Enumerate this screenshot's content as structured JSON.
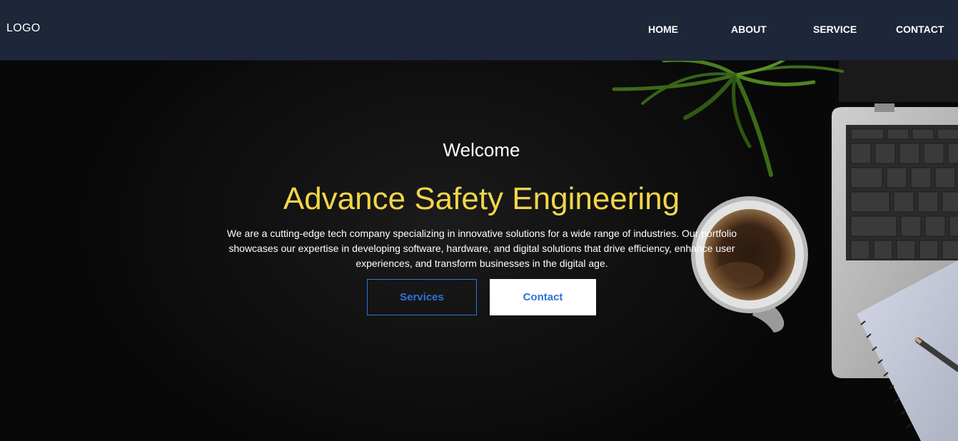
{
  "header": {
    "logo": "LOGO",
    "nav": {
      "home": "HOME",
      "about": "ABOUT",
      "service": "SERVICE",
      "contact": "CONTACT"
    }
  },
  "hero": {
    "welcome": "Welcome",
    "title": "Advance Safety Engineering",
    "description": "We are a cutting-edge tech company specializing in innovative solutions for a wide range of industries. Our portfolio showcases our expertise in developing software, hardware, and digital solutions that drive efficiency, enhance user experiences, and transform businesses in the digital age.",
    "buttons": {
      "services": "Services",
      "contact": "Contact"
    }
  },
  "colors": {
    "navbar_bg": "#1e2639",
    "headline": "#f3d54a",
    "accent_blue": "#2f73d8"
  }
}
